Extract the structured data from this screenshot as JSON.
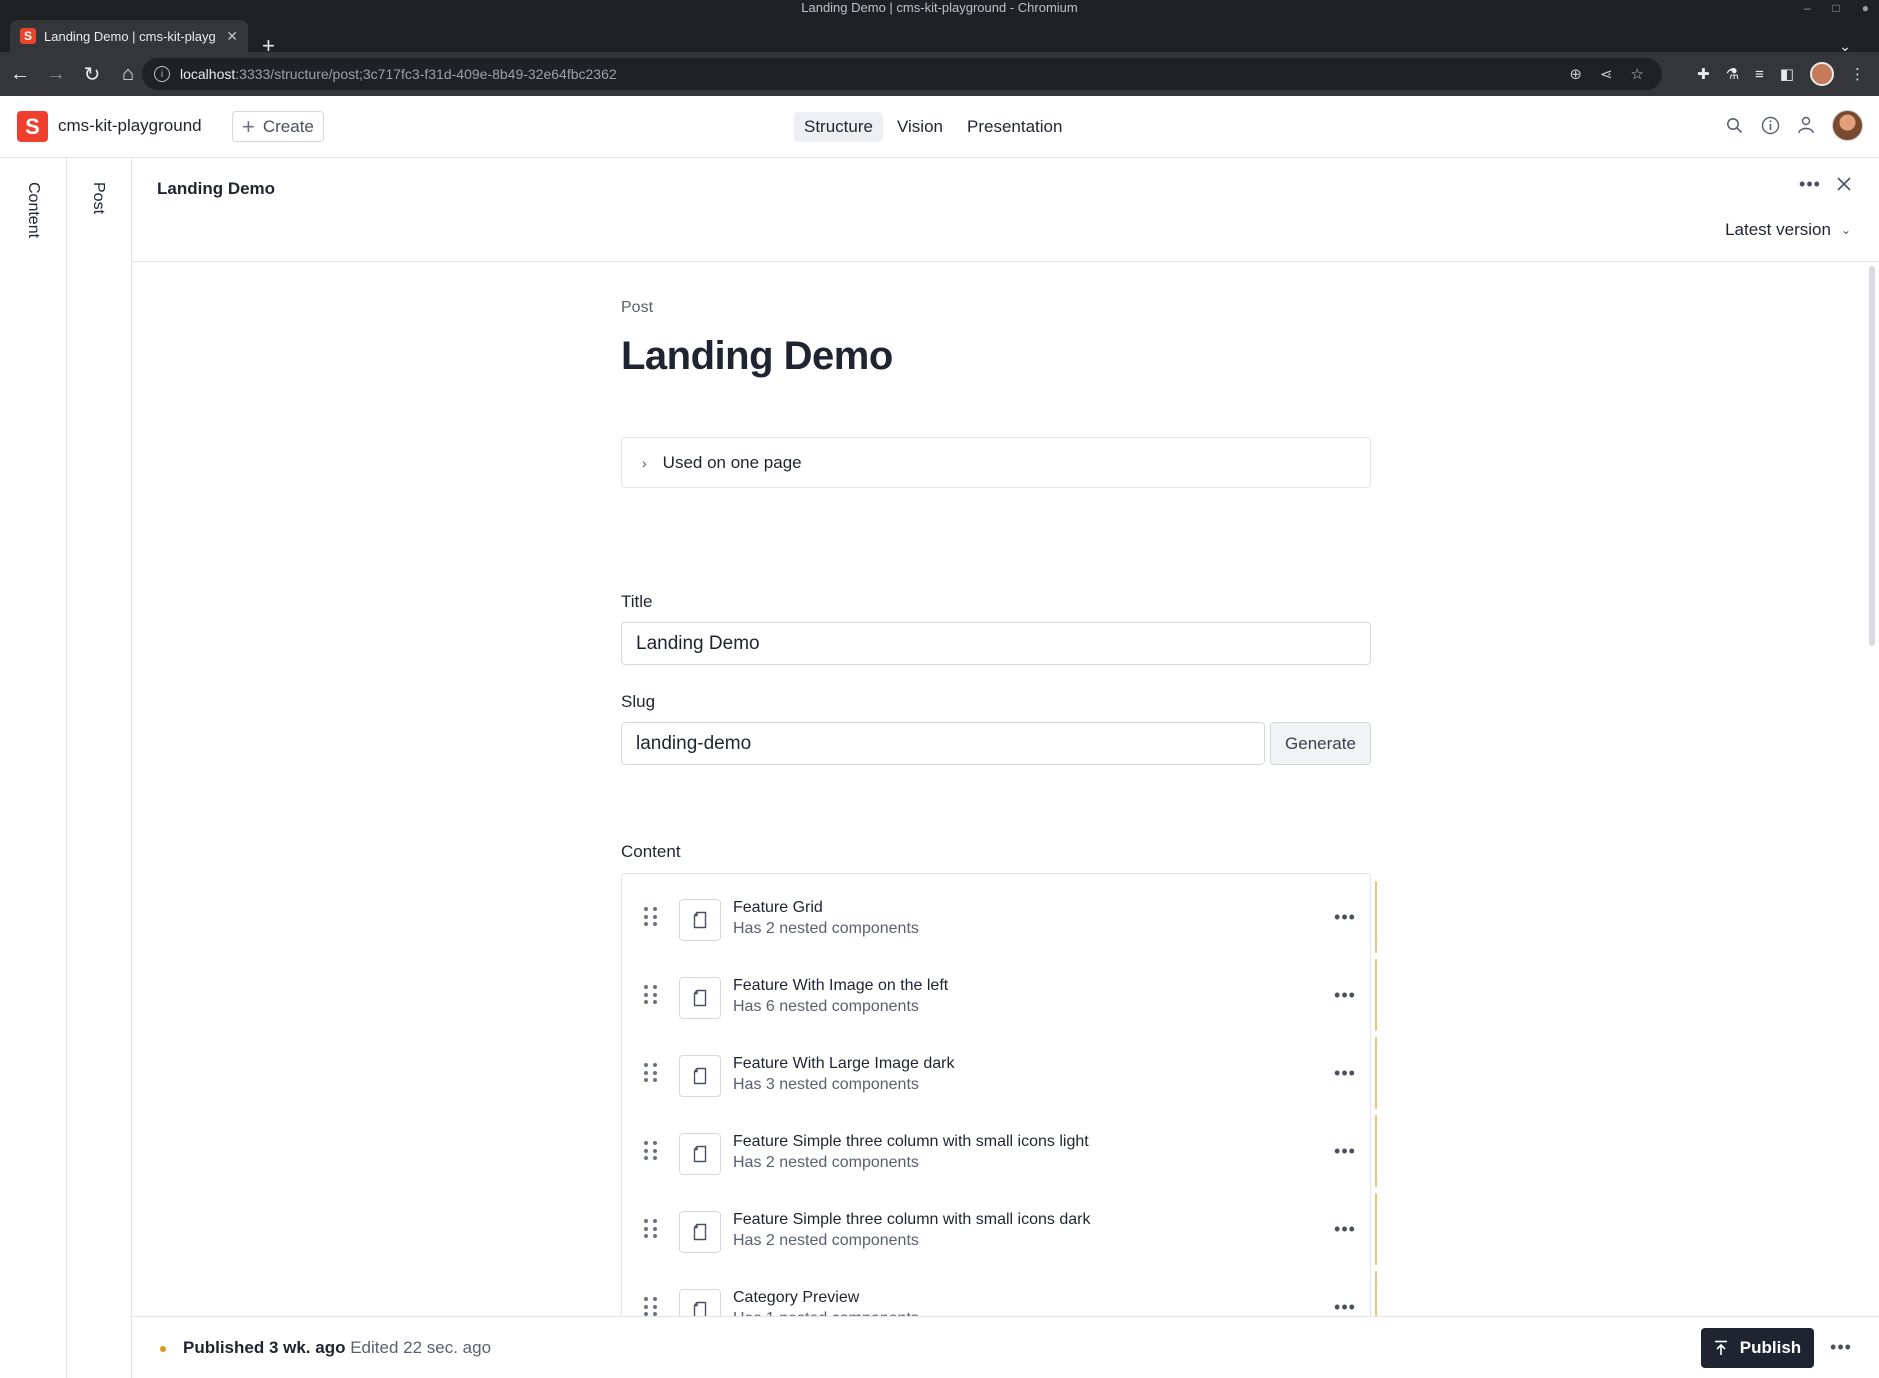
{
  "window": {
    "title": "Landing Demo | cms-kit-playground - Chromium"
  },
  "browser": {
    "tab_title": "Landing Demo | cms-kit-playg",
    "tab_favicon": "S",
    "url_host": "localhost",
    "url_path": ":3333/structure/post;3c717fc3-f31d-409e-8b49-32e64fbc2362"
  },
  "app": {
    "brand_initial": "S",
    "project_name": "cms-kit-playground",
    "create_label": "Create",
    "nav": [
      {
        "label": "Structure",
        "active": true
      },
      {
        "label": "Vision",
        "active": false
      },
      {
        "label": "Presentation",
        "active": false
      }
    ],
    "brand_color": "#f03e2f"
  },
  "rails": {
    "content": "Content",
    "post": "Post"
  },
  "document": {
    "pane_title": "Landing Demo",
    "version": "Latest version",
    "type_label": "Post",
    "title": "Landing Demo",
    "used_on": "Used on one page",
    "fields": {
      "title_label": "Title",
      "title_value": "Landing Demo",
      "slug_label": "Slug",
      "slug_value": "landing-demo",
      "generate_label": "Generate",
      "content_label": "Content"
    },
    "content_items": [
      {
        "title": "Feature Grid",
        "subtitle": "Has 2 nested components"
      },
      {
        "title": "Feature With Image on the left",
        "subtitle": "Has 6 nested components"
      },
      {
        "title": "Feature With Large Image dark",
        "subtitle": "Has 3 nested components"
      },
      {
        "title": "Feature Simple three column with small icons light",
        "subtitle": "Has 2 nested components"
      },
      {
        "title": "Feature Simple three column with small icons dark",
        "subtitle": "Has 2 nested components"
      },
      {
        "title": "Category Preview",
        "subtitle": "Has 1 nested components"
      }
    ]
  },
  "footer": {
    "published": "Published 3 wk. ago",
    "edited": "Edited 22 sec. ago",
    "publish_label": "Publish",
    "status_color": "#e0961c"
  }
}
